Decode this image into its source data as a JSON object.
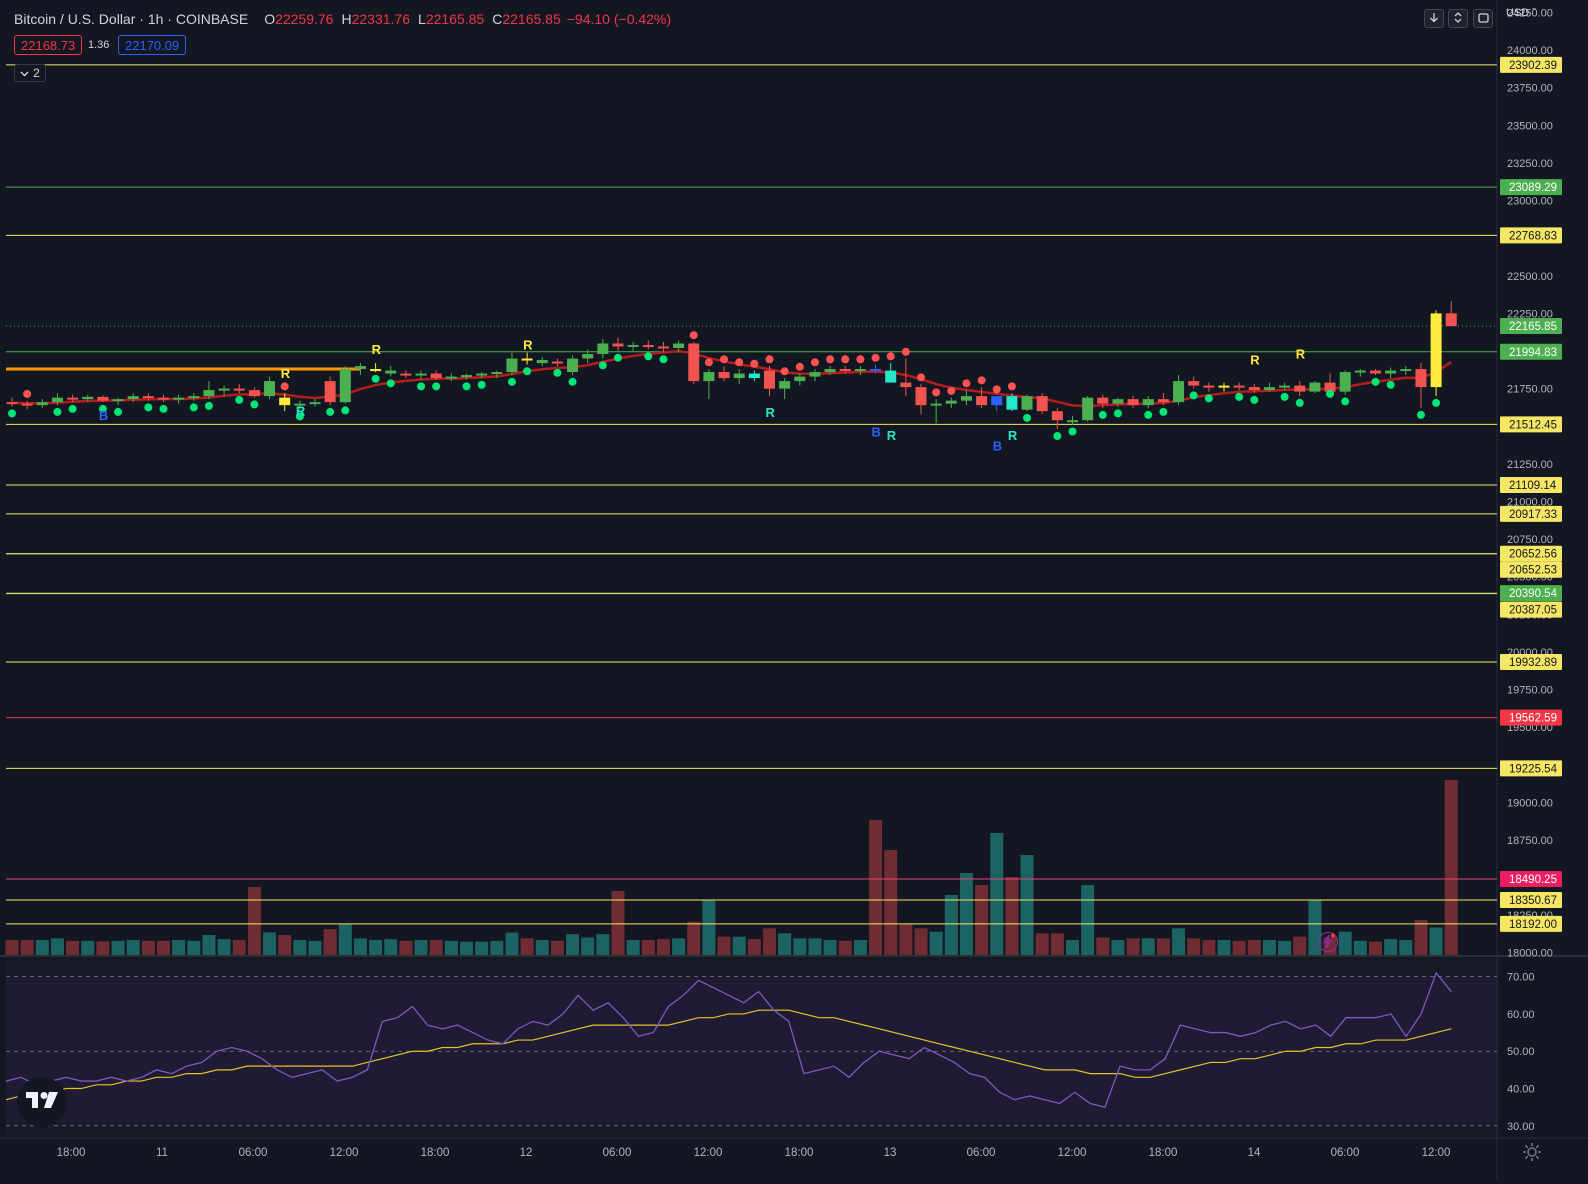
{
  "header": {
    "symbol": "Bitcoin / U.S. Dollar · 1h · COINBASE",
    "o_label": "O",
    "o_value": "22259.76",
    "h_label": "H",
    "h_value": "22331.76",
    "l_label": "L",
    "l_value": "22165.85",
    "c_label": "C",
    "c_value": "22165.85",
    "change": "−94.10 (−0.42%)"
  },
  "quote": {
    "bid": "22168.73",
    "spread": "1.36",
    "ask": "22170.09"
  },
  "indicators_toggle": {
    "count": "2"
  },
  "currency": "USD",
  "colors": {
    "background": "#131722",
    "up": "#4caf50",
    "down": "#f05350",
    "yellow_line": "#f5e663",
    "green_line": "#4caf50",
    "red_line": "#f23645",
    "pink_line": "#ec407a",
    "rsi_line": "#7e57c2",
    "rsi_ma": "#e6c229",
    "rsi_band": "#1e1b33",
    "vol_up": "#1e6b6b",
    "vol_down": "#7b2f35",
    "dot_green": "#00e676",
    "dot_red": "#ff5252"
  },
  "chart_data": {
    "type": "candlestick",
    "price_axis_ticks": [
      "24250.00",
      "24000.00",
      "23750.00",
      "23500.00",
      "23250.00",
      "23000.00",
      "22750.00",
      "22500.00",
      "22250.00",
      "22000.00",
      "21750.00",
      "21500.00",
      "21250.00",
      "21000.00",
      "20750.00",
      "20500.00",
      "20250.00",
      "20000.00",
      "19750.00",
      "19500.00",
      "19250.00",
      "19000.00",
      "18750.00",
      "18500.00",
      "18250.00",
      "18000.00"
    ],
    "price_range": [
      17985,
      24300
    ],
    "time_axis_ticks": [
      "18:00",
      "11",
      "06:00",
      "12:00",
      "18:00",
      "12",
      "06:00",
      "12:00",
      "18:00",
      "13",
      "06:00",
      "12:00",
      "18:00",
      "14",
      "06:00",
      "12:00"
    ],
    "horizontal_levels": [
      {
        "price": 23902.39,
        "label": "23902.39",
        "color": "yellow"
      },
      {
        "price": 23089.29,
        "label": "23089.29",
        "color": "green"
      },
      {
        "price": 22768.83,
        "label": "22768.83",
        "color": "yellow"
      },
      {
        "price": 22165.85,
        "label": "22165.85",
        "color": "last_price"
      },
      {
        "price": 21994.83,
        "label": "21994.83",
        "color": "green"
      },
      {
        "price": 21512.45,
        "label": "21512.45",
        "color": "yellow"
      },
      {
        "price": 21109.14,
        "label": "21109.14",
        "color": "yellow"
      },
      {
        "price": 20917.33,
        "label": "20917.33",
        "color": "yellow"
      },
      {
        "price": 20652.56,
        "label": "20652.56",
        "color": "yellow"
      },
      {
        "price": 20652.53,
        "label": "20652.53",
        "color": "yellow"
      },
      {
        "price": 20390.54,
        "label": "20390.54",
        "color": "green"
      },
      {
        "price": 20387.05,
        "label": "20387.05",
        "color": "yellow"
      },
      {
        "price": 19932.89,
        "label": "19932.89",
        "color": "yellow"
      },
      {
        "price": 19562.59,
        "label": "19562.59",
        "color": "red"
      },
      {
        "price": 19225.54,
        "label": "19225.54",
        "color": "yellow"
      },
      {
        "price": 18490.25,
        "label": "18490.25",
        "color": "pink"
      },
      {
        "price": 18350.67,
        "label": "18350.67",
        "color": "yellow"
      },
      {
        "price": 18192.0,
        "label": "18192.00",
        "color": "yellow"
      }
    ],
    "candles": [
      [
        21660,
        21690,
        21630,
        21650
      ],
      [
        21650,
        21670,
        21610,
        21640
      ],
      [
        21640,
        21680,
        21620,
        21660
      ],
      [
        21660,
        21720,
        21640,
        21690
      ],
      [
        21690,
        21710,
        21660,
        21680
      ],
      [
        21680,
        21710,
        21660,
        21695
      ],
      [
        21695,
        21705,
        21660,
        21670
      ],
      [
        21670,
        21690,
        21640,
        21680
      ],
      [
        21680,
        21720,
        21660,
        21700
      ],
      [
        21700,
        21720,
        21670,
        21690
      ],
      [
        21690,
        21710,
        21660,
        21680
      ],
      [
        21680,
        21710,
        21650,
        21690
      ],
      [
        21690,
        21720,
        21670,
        21700
      ],
      [
        21700,
        21800,
        21680,
        21740
      ],
      [
        21740,
        21770,
        21700,
        21750
      ],
      [
        21750,
        21780,
        21720,
        21740
      ],
      [
        21740,
        21760,
        21690,
        21700
      ],
      [
        21700,
        21830,
        21680,
        21800
      ],
      [
        21690,
        21720,
        21600,
        21640
      ],
      [
        21640,
        21670,
        21610,
        21650
      ],
      [
        21650,
        21680,
        21630,
        21660
      ],
      [
        21800,
        21830,
        21640,
        21660
      ],
      [
        21660,
        21900,
        21650,
        21880
      ],
      [
        21880,
        21920,
        21840,
        21900
      ],
      [
        21880,
        21920,
        21860,
        21880
      ],
      [
        21850,
        21900,
        21830,
        21870
      ],
      [
        21850,
        21870,
        21820,
        21840
      ],
      [
        21840,
        21870,
        21810,
        21850
      ],
      [
        21850,
        21870,
        21810,
        21820
      ],
      [
        21820,
        21850,
        21800,
        21830
      ],
      [
        21830,
        21850,
        21810,
        21840
      ],
      [
        21840,
        21860,
        21820,
        21850
      ],
      [
        21850,
        21870,
        21820,
        21860
      ],
      [
        21860,
        21990,
        21840,
        21950
      ],
      [
        21950,
        21990,
        21910,
        21940
      ],
      [
        21920,
        21960,
        21900,
        21940
      ],
      [
        21930,
        21950,
        21900,
        21920
      ],
      [
        21860,
        21970,
        21840,
        21950
      ],
      [
        21950,
        22010,
        21920,
        21980
      ],
      [
        21980,
        22080,
        21950,
        22050
      ],
      [
        22050,
        22090,
        22000,
        22030
      ],
      [
        22030,
        22060,
        22000,
        22040
      ],
      [
        22040,
        22070,
        22010,
        22030
      ],
      [
        22030,
        22060,
        21990,
        22020
      ],
      [
        22020,
        22070,
        21990,
        22050
      ],
      [
        22050,
        22060,
        21780,
        21800
      ],
      [
        21800,
        21880,
        21680,
        21860
      ],
      [
        21860,
        21900,
        21800,
        21820
      ],
      [
        21820,
        21880,
        21780,
        21850
      ],
      [
        21850,
        21870,
        21800,
        21820
      ],
      [
        21870,
        21900,
        21700,
        21750
      ],
      [
        21750,
        21820,
        21680,
        21800
      ],
      [
        21800,
        21850,
        21770,
        21830
      ],
      [
        21830,
        21880,
        21800,
        21860
      ],
      [
        21860,
        21900,
        21840,
        21880
      ],
      [
        21880,
        21900,
        21850,
        21870
      ],
      [
        21870,
        21900,
        21840,
        21880
      ],
      [
        21880,
        21910,
        21850,
        21870
      ],
      [
        21870,
        21920,
        21840,
        21790
      ],
      [
        21790,
        21950,
        21700,
        21760
      ],
      [
        21760,
        21780,
        21580,
        21640
      ],
      [
        21650,
        21680,
        21520,
        21650
      ],
      [
        21650,
        21690,
        21620,
        21670
      ],
      [
        21670,
        21740,
        21640,
        21700
      ],
      [
        21700,
        21760,
        21620,
        21640
      ],
      [
        21640,
        21700,
        21600,
        21700
      ],
      [
        21700,
        21720,
        21600,
        21610
      ],
      [
        21610,
        21710,
        21600,
        21700
      ],
      [
        21700,
        21720,
        21580,
        21600
      ],
      [
        21600,
        21620,
        21480,
        21540
      ],
      [
        21540,
        21570,
        21510,
        21540
      ],
      [
        21540,
        21700,
        21530,
        21690
      ],
      [
        21690,
        21710,
        21620,
        21650
      ],
      [
        21650,
        21690,
        21630,
        21680
      ],
      [
        21680,
        21700,
        21620,
        21640
      ],
      [
        21640,
        21700,
        21620,
        21680
      ],
      [
        21680,
        21720,
        21640,
        21660
      ],
      [
        21660,
        21840,
        21640,
        21800
      ],
      [
        21800,
        21830,
        21750,
        21770
      ],
      [
        21770,
        21790,
        21730,
        21760
      ],
      [
        21760,
        21790,
        21730,
        21770
      ],
      [
        21770,
        21790,
        21740,
        21760
      ],
      [
        21760,
        21780,
        21720,
        21740
      ],
      [
        21740,
        21790,
        21730,
        21760
      ],
      [
        21760,
        21790,
        21740,
        21770
      ],
      [
        21770,
        21800,
        21700,
        21730
      ],
      [
        21730,
        21800,
        21720,
        21790
      ],
      [
        21790,
        21850,
        21760,
        21730
      ],
      [
        21730,
        21870,
        21710,
        21860
      ],
      [
        21860,
        21880,
        21830,
        21870
      ],
      [
        21870,
        21880,
        21840,
        21850
      ],
      [
        21850,
        21890,
        21820,
        21870
      ],
      [
        21870,
        21900,
        21840,
        21880
      ],
      [
        21880,
        21920,
        21620,
        21760
      ],
      [
        21760,
        22270,
        21700,
        22250
      ],
      [
        22250,
        22332,
        22165,
        22166
      ]
    ],
    "candle_colors_note": "yellow candles and blue/cyan candles are indicator highlights",
    "volume_note": "volume histogram overlay at bottom of price pane",
    "signal_labels": [
      {
        "text": "B",
        "color": "blue"
      },
      {
        "text": "R",
        "color": "yellow"
      },
      {
        "text": "R",
        "color": "cyan"
      },
      {
        "text": "R",
        "color": "yellow"
      },
      {
        "text": "R",
        "color": "yellow"
      },
      {
        "text": "R",
        "color": "cyan"
      },
      {
        "text": "B",
        "color": "blue"
      },
      {
        "text": "R",
        "color": "cyan"
      },
      {
        "text": "B",
        "color": "blue"
      },
      {
        "text": "R",
        "color": "cyan"
      },
      {
        "text": "R",
        "color": "yellow"
      },
      {
        "text": "R",
        "color": "yellow"
      }
    ],
    "rsi": {
      "axis_ticks": [
        "70.00",
        "60.00",
        "50.00",
        "40.00",
        "30.00"
      ],
      "range": [
        27,
        75
      ],
      "bands": [
        70,
        50,
        30
      ],
      "values": [
        42,
        43,
        41,
        42,
        43,
        42,
        42,
        43,
        42,
        43,
        45,
        44,
        46,
        47,
        50,
        51,
        50,
        48,
        45,
        43,
        44,
        45,
        42,
        43,
        45,
        58,
        59,
        62,
        57,
        56,
        57,
        55,
        53,
        52,
        56,
        58,
        57,
        60,
        65,
        61,
        63,
        59,
        54,
        55,
        62,
        65,
        69,
        67,
        65,
        63,
        66,
        61,
        58,
        44,
        45,
        46,
        43,
        47,
        50,
        49,
        48,
        51,
        49,
        47,
        44,
        43,
        39,
        37,
        38,
        37,
        36,
        39,
        36,
        35,
        46,
        45,
        45,
        48,
        57,
        56,
        55,
        55,
        54,
        55,
        57,
        58,
        56,
        57,
        54,
        59,
        59,
        59,
        60,
        54,
        60,
        71,
        66
      ],
      "ma_values": [
        37,
        38,
        38,
        39,
        40,
        40,
        41,
        41,
        42,
        42,
        43,
        43,
        44,
        44,
        45,
        45,
        46,
        46,
        46,
        46,
        46,
        46,
        46,
        46,
        47,
        48,
        49,
        50,
        50,
        51,
        51,
        52,
        52,
        52,
        53,
        53,
        54,
        55,
        56,
        57,
        57,
        57,
        57,
        57,
        57,
        58,
        59,
        59,
        60,
        60,
        61,
        61,
        61,
        60,
        59,
        59,
        58,
        57,
        56,
        55,
        54,
        53,
        52,
        51,
        50,
        49,
        48,
        47,
        46,
        45,
        45,
        45,
        44,
        44,
        44,
        43,
        43,
        44,
        45,
        46,
        47,
        47,
        48,
        48,
        49,
        50,
        50,
        51,
        51,
        52,
        52,
        53,
        53,
        53,
        54,
        55,
        56
      ]
    }
  }
}
